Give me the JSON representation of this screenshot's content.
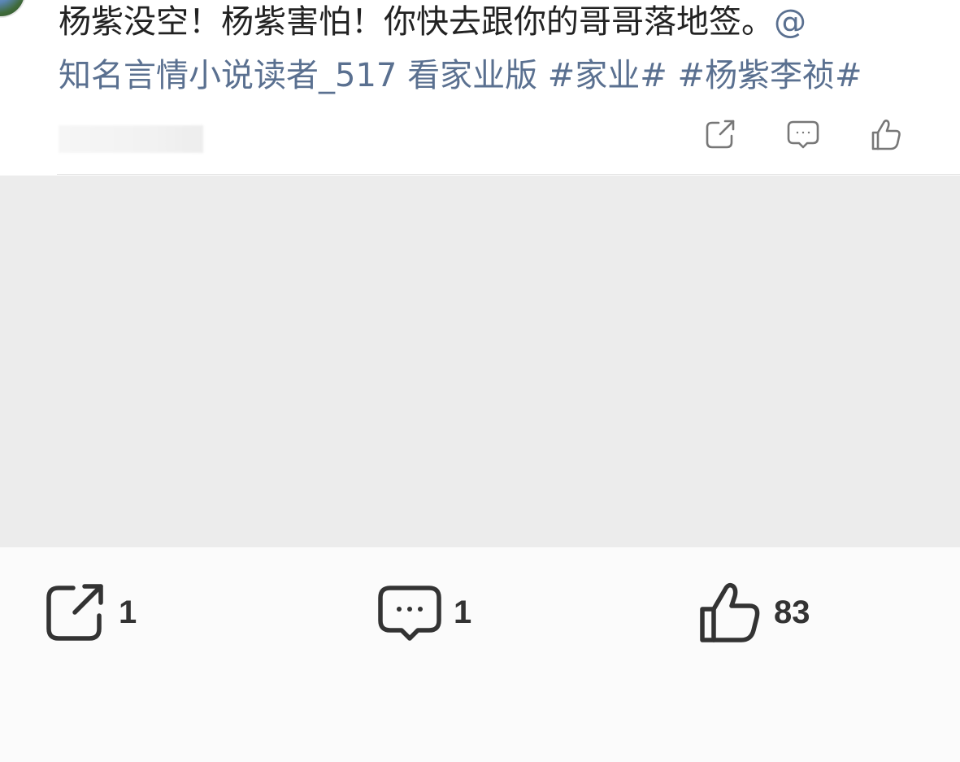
{
  "post": {
    "text_line1": "杨紫没空！杨紫害怕！你快去跟你的哥哥落地签。",
    "mention_at": "@",
    "mention_name": "知名言情小说读者_517",
    "text_after_mention": " 看家业版 ",
    "hashtags": [
      "#家业#",
      "#杨紫李祯#"
    ]
  },
  "mini_actions": {
    "share_icon": "share-icon",
    "comment_icon": "comment-icon",
    "like_icon": "like-icon"
  },
  "actions": {
    "share": {
      "icon": "share-icon",
      "count": "1"
    },
    "comment": {
      "icon": "comment-icon",
      "count": "1"
    },
    "like": {
      "icon": "like-icon",
      "count": "83"
    }
  },
  "colors": {
    "link": "#5a7090",
    "text": "#222222",
    "icon": "#333333",
    "placeholder": "#ececec"
  }
}
